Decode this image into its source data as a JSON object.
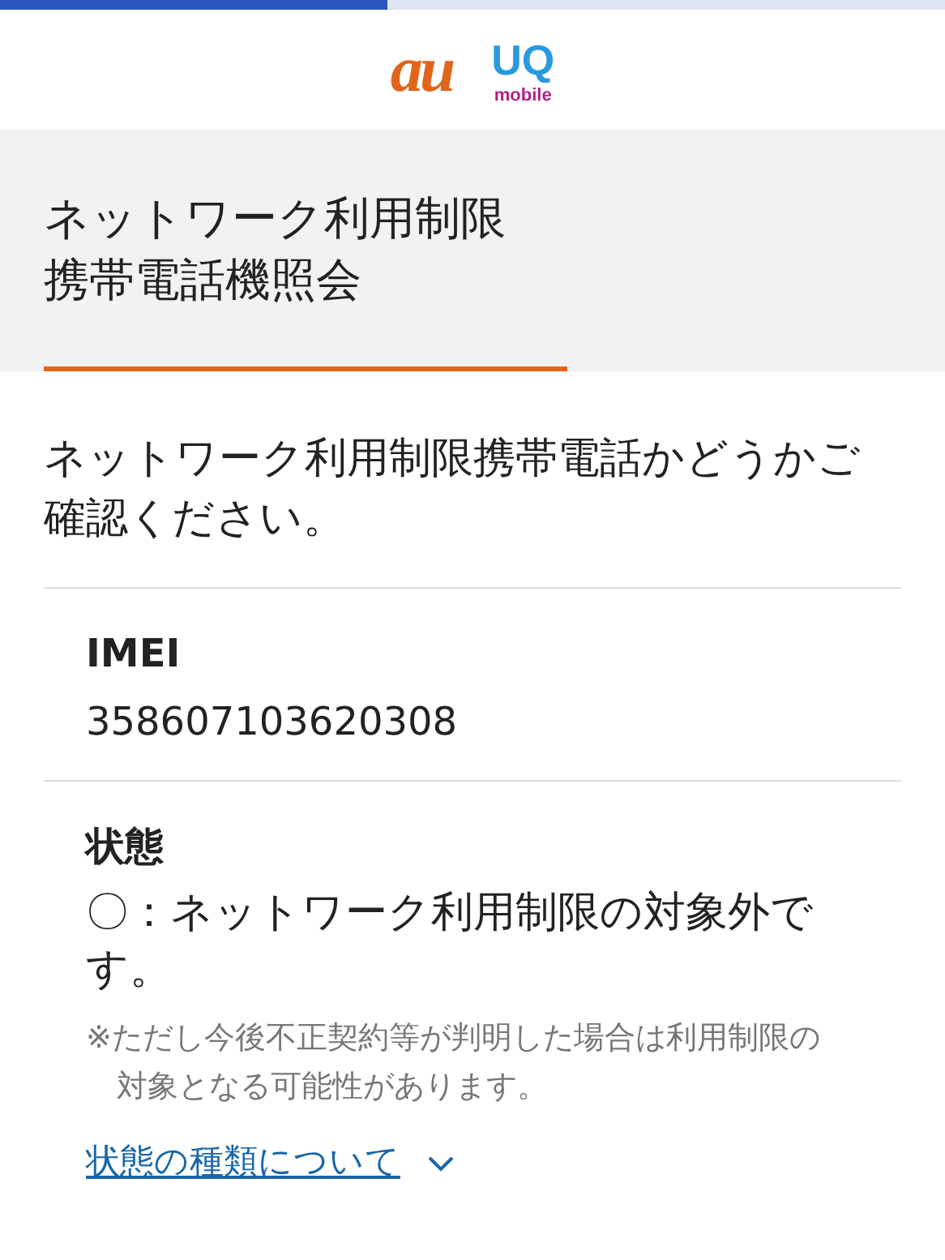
{
  "load_progress": {
    "level": 0.41
  },
  "logos": [
    {
      "text": "au",
      "kind": "au"
    },
    {
      "text": "UQ",
      "subtext": "mobile",
      "kind": "uq"
    }
  ],
  "header": {
    "title_lines": [
      "ネットワーク利用制限",
      "携帯電話機照会"
    ]
  },
  "intro": "ネットワーク利用制限携帯電話かどうかご確認ください。",
  "imei": {
    "label": "IMEI",
    "value": "358607103620308"
  },
  "status": {
    "label": "状態",
    "mark": "〇",
    "text": "：ネットワーク利用制限の対象外です。",
    "note_mark": "※",
    "note": "ただし今後不正契約等が判明した場合は利用制限の対象となる可能性があります。"
  },
  "link": {
    "text": "状態の種類について",
    "expanded": false
  }
}
